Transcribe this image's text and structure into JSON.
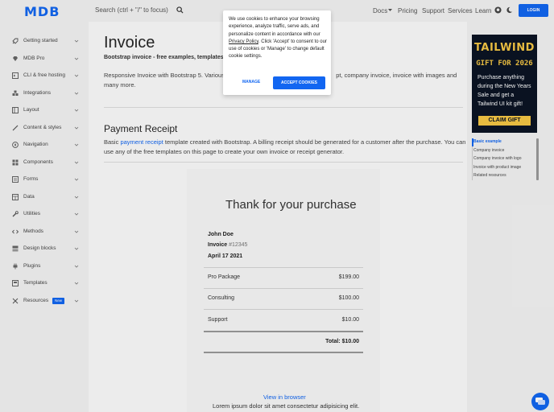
{
  "header": {
    "logo": "MDB",
    "search_placeholder": "Search (ctrl + \"/\" to focus)",
    "nav": [
      "Docs",
      "Pricing",
      "Support",
      "Services",
      "Learn"
    ],
    "login": "LOGIN"
  },
  "sidebar": {
    "items": [
      {
        "label": "Getting started",
        "icon": "rocket-icon"
      },
      {
        "label": "MDB Pro",
        "icon": "gem-icon"
      },
      {
        "label": "CLI & free hosting",
        "icon": "terminal-icon"
      },
      {
        "label": "Integrations",
        "icon": "cubes-icon"
      },
      {
        "label": "Layout",
        "icon": "layout-icon"
      },
      {
        "label": "Content & styles",
        "icon": "brush-icon"
      },
      {
        "label": "Navigation",
        "icon": "compass-icon"
      },
      {
        "label": "Components",
        "icon": "components-icon"
      },
      {
        "label": "Forms",
        "icon": "forms-icon"
      },
      {
        "label": "Data",
        "icon": "table-icon"
      },
      {
        "label": "Utilities",
        "icon": "wrench-icon"
      },
      {
        "label": "Methods",
        "icon": "code-icon"
      },
      {
        "label": "Design blocks",
        "icon": "blocks-icon"
      },
      {
        "label": "Plugins",
        "icon": "plug-icon"
      },
      {
        "label": "Templates",
        "icon": "template-icon"
      },
      {
        "label": "Resources",
        "icon": "resources-icon",
        "badge": "New"
      }
    ]
  },
  "main": {
    "title": "Invoice",
    "subtitle": "Bootstrap invoice - free examples, templates &",
    "lead_start": "Responsive Invoice with Bootstrap 5. Various e",
    "lead_end": "pt, company invoice, invoice with images and many more.",
    "section_title": "Payment Receipt",
    "desc_before": "Basic ",
    "desc_link": "payment receipt",
    "desc_after": " template created with Bootstrap. A billing receipt should be generated for a customer after the purchase. You can use any of the free templates on this page to create your own invoice or receipt generator."
  },
  "receipt": {
    "thanks": "Thank for your purchase",
    "name": "John Doe",
    "invoice_label": "Invoice",
    "invoice_no": "#12345",
    "date": "April 17 2021",
    "rows": [
      {
        "label": "Pro Package",
        "amount": "$199.00"
      },
      {
        "label": "Consulting",
        "amount": "$100.00"
      },
      {
        "label": "Support",
        "amount": "$10.00"
      }
    ],
    "total": "Total: $10.00",
    "view_browser": "View in browser",
    "lorem": "Lorem ipsum dolor sit amet consectetur adipisicing elit."
  },
  "ad": {
    "title": "TAILWIND",
    "subtitle": "GIFT FOR 2026",
    "body": "Purchase anything during the New Years Sale and get a Tailwind UI kit gift!",
    "cta": "CLAIM GIFT",
    "accent": "#f6c744",
    "bg": "#0b1424"
  },
  "toc": {
    "items": [
      "Basic example",
      "Company invoice",
      "Company invoice with logo",
      "Invoice with product image",
      "Related resources"
    ]
  },
  "cookie": {
    "text_start": "We use cookies to enhance your browsing experience, analyze traffic, serve ads, and personalize content in accordance with our ",
    "policy_link": "Privacy Policy",
    "text_end": ". Click 'Accept' to consent to our use of cookies or 'Manage' to change default cookie settings.",
    "manage": "MANAGE",
    "accept": "ACCEPT COOKIES"
  },
  "colors": {
    "primary": "#1266f1"
  }
}
